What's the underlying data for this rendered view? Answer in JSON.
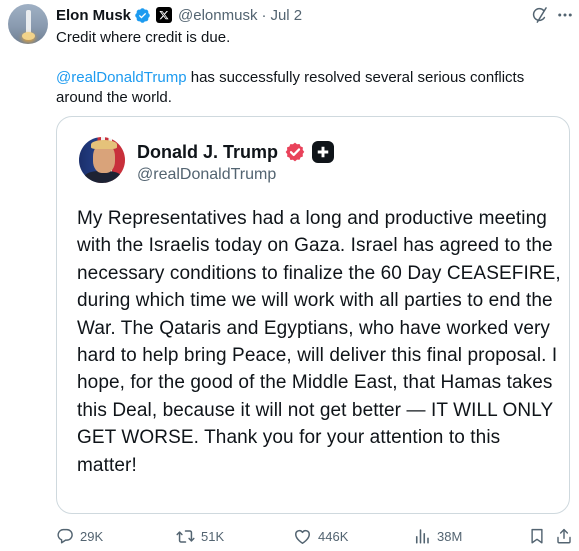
{
  "author": {
    "name": "Elon Musk",
    "handle": "@elonmusk",
    "separator": "·",
    "date": "Jul 2"
  },
  "tweet": {
    "line1": "Credit where credit is due.",
    "mention": "@realDonaldTrump",
    "line2_rest": " has successfully resolved several serious conflicts around the world."
  },
  "quoted": {
    "name": "Donald J. Trump",
    "handle": "@realDonaldTrump",
    "body": "My Representatives had a long and productive meeting with the Israelis today on Gaza. Israel has agreed to the necessary conditions to finalize the 60 Day CEASEFIRE, during which time we will work with all parties to end the War. The Qataris and Egyptians, who have worked very hard to help bring Peace, will deliver this final proposal. I hope, for the good of the Middle East, that Hamas takes this Deal, because it will not get better — IT WILL ONLY GET WORSE. Thank you for your attention to this matter!"
  },
  "stats": {
    "replies": "29K",
    "reposts": "51K",
    "likes": "446K",
    "views": "38M"
  },
  "colors": {
    "text": "#0f1419",
    "muted": "#536471",
    "link": "#1d9bf0",
    "verified_blue": "#1d9bf0",
    "truth_badge": "#e9425a",
    "border": "#cfd9de"
  },
  "icons": [
    "verified-badge-icon",
    "x-affiliate-icon",
    "grok-icon",
    "more-icon",
    "reply-icon",
    "repost-icon",
    "like-icon",
    "views-icon",
    "bookmark-icon",
    "share-icon"
  ]
}
